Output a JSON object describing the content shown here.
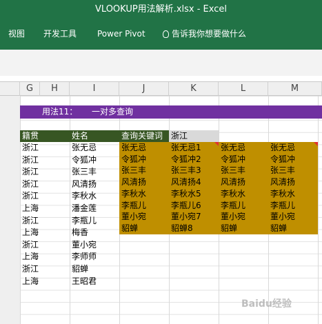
{
  "window": {
    "title": "VLOOKUP用法解析.xlsx  -  Excel"
  },
  "ribbon": {
    "tabs": [
      "视图",
      "开发工具",
      "Power Pivot"
    ],
    "tell_me": "告诉我你想要做什么"
  },
  "columns": [
    "G",
    "H",
    "I",
    "J",
    "K",
    "L",
    "M"
  ],
  "sheet": {
    "method_label": "用法11：",
    "method_title": "一对多查询",
    "headers": {
      "native": "籍贯",
      "name": "姓名",
      "keyword": "查询关键词",
      "lookup_value": "浙江"
    },
    "data_rows": [
      {
        "native": "浙江",
        "name": "张无忌"
      },
      {
        "native": "浙江",
        "name": "令狐冲"
      },
      {
        "native": "浙江",
        "name": "张三丰"
      },
      {
        "native": "浙江",
        "name": "风清扬"
      },
      {
        "native": "浙江",
        "name": "李秋水"
      },
      {
        "native": "上海",
        "name": "潘金莲"
      },
      {
        "native": "浙江",
        "name": "李瓶儿"
      },
      {
        "native": "上海",
        "name": "梅香"
      },
      {
        "native": "浙江",
        "name": "董小宛"
      },
      {
        "native": "上海",
        "name": "李师师"
      },
      {
        "native": "浙江",
        "name": "貂蝉"
      },
      {
        "native": "上海",
        "name": "王昭君"
      }
    ],
    "result_rows": [
      [
        "张无忌",
        "张无忌1",
        "张无忌",
        "张无忌"
      ],
      [
        "令狐冲",
        "令狐冲2",
        "令狐冲",
        "令狐冲"
      ],
      [
        "张三丰",
        "张三丰3",
        "张三丰",
        "张三丰"
      ],
      [
        "风清扬",
        "风清扬4",
        "风清扬",
        "风清扬"
      ],
      [
        "李秋水",
        "李秋水5",
        "李秋水",
        "李秋水"
      ],
      [
        "李瓶儿",
        "李瓶儿6",
        "李瓶儿",
        "李瓶儿"
      ],
      [
        "董小宛",
        "董小宛7",
        "董小宛",
        "董小宛"
      ],
      [
        "貂蝉",
        "貂蝉8",
        "貂蝉",
        "貂蝉"
      ]
    ]
  },
  "watermark": "Baidu经验",
  "colors": {
    "excel_green": "#217346",
    "purple_band": "#7030a0",
    "header_green": "#375623",
    "result_gold": "#bf8f00"
  }
}
